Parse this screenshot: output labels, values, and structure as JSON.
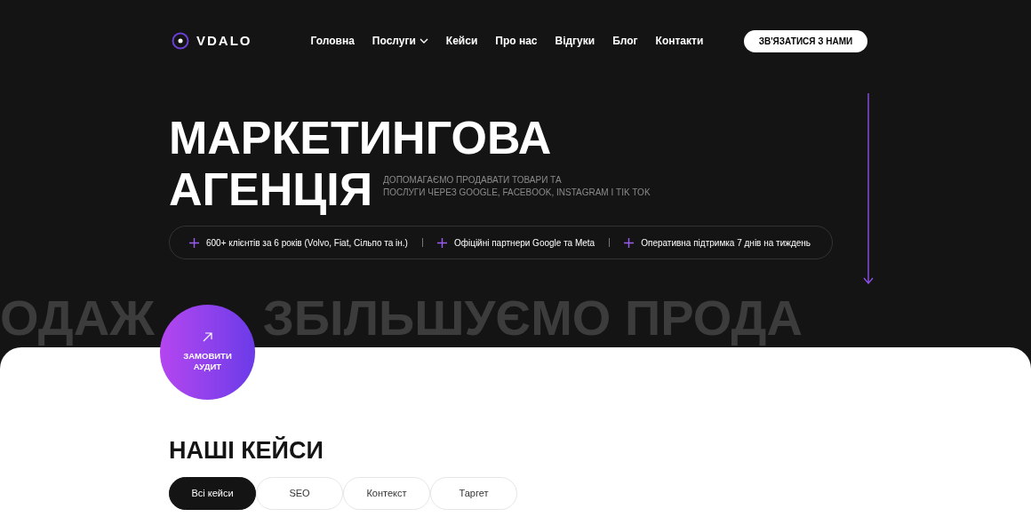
{
  "header": {
    "logo": "VDALO",
    "nav": [
      {
        "label": "Головна",
        "dropdown": false
      },
      {
        "label": "Послуги",
        "dropdown": true
      },
      {
        "label": "Кейси",
        "dropdown": false
      },
      {
        "label": "Про нас",
        "dropdown": false
      },
      {
        "label": "Відгуки",
        "dropdown": false
      },
      {
        "label": "Блог",
        "dropdown": false
      },
      {
        "label": "Контакти",
        "dropdown": false
      }
    ],
    "cta": "ЗВ'ЯЗАТИСЯ З НАМИ"
  },
  "hero": {
    "title_line_1": "МАРКЕТИНГОВА",
    "title_line_2": "АГЕНЦІЯ",
    "subtitle": [
      "ДОПОМАГАЄМО ПРОДАВАТИ ТОВАРИ ТА",
      "ПОСЛУГИ ЧЕРЕЗ GOOGLE, FACEBOOK, INSTAGRAM І TIK TOK"
    ],
    "features": [
      "600+ клієнтів за 6 років (Volvo, Fiat, Сільпо та ін.)",
      "Офіційні партнери Google та Meta",
      "Оперативна підтримка 7 днів на тиждень"
    ],
    "marquee": [
      "ОДАЖ",
      "ЗБІЛЬШУЄМО ПРОДА"
    ],
    "audit_button": [
      "ЗАМОВИТИ",
      "АУДИТ"
    ]
  },
  "cases": {
    "title": "НАШІ КЕЙСИ",
    "filters": [
      {
        "label": "Всі кейси",
        "selected": true
      },
      {
        "label": "SEO",
        "selected": false
      },
      {
        "label": "Контекст",
        "selected": false
      },
      {
        "label": "Таргет",
        "selected": false
      }
    ]
  }
}
